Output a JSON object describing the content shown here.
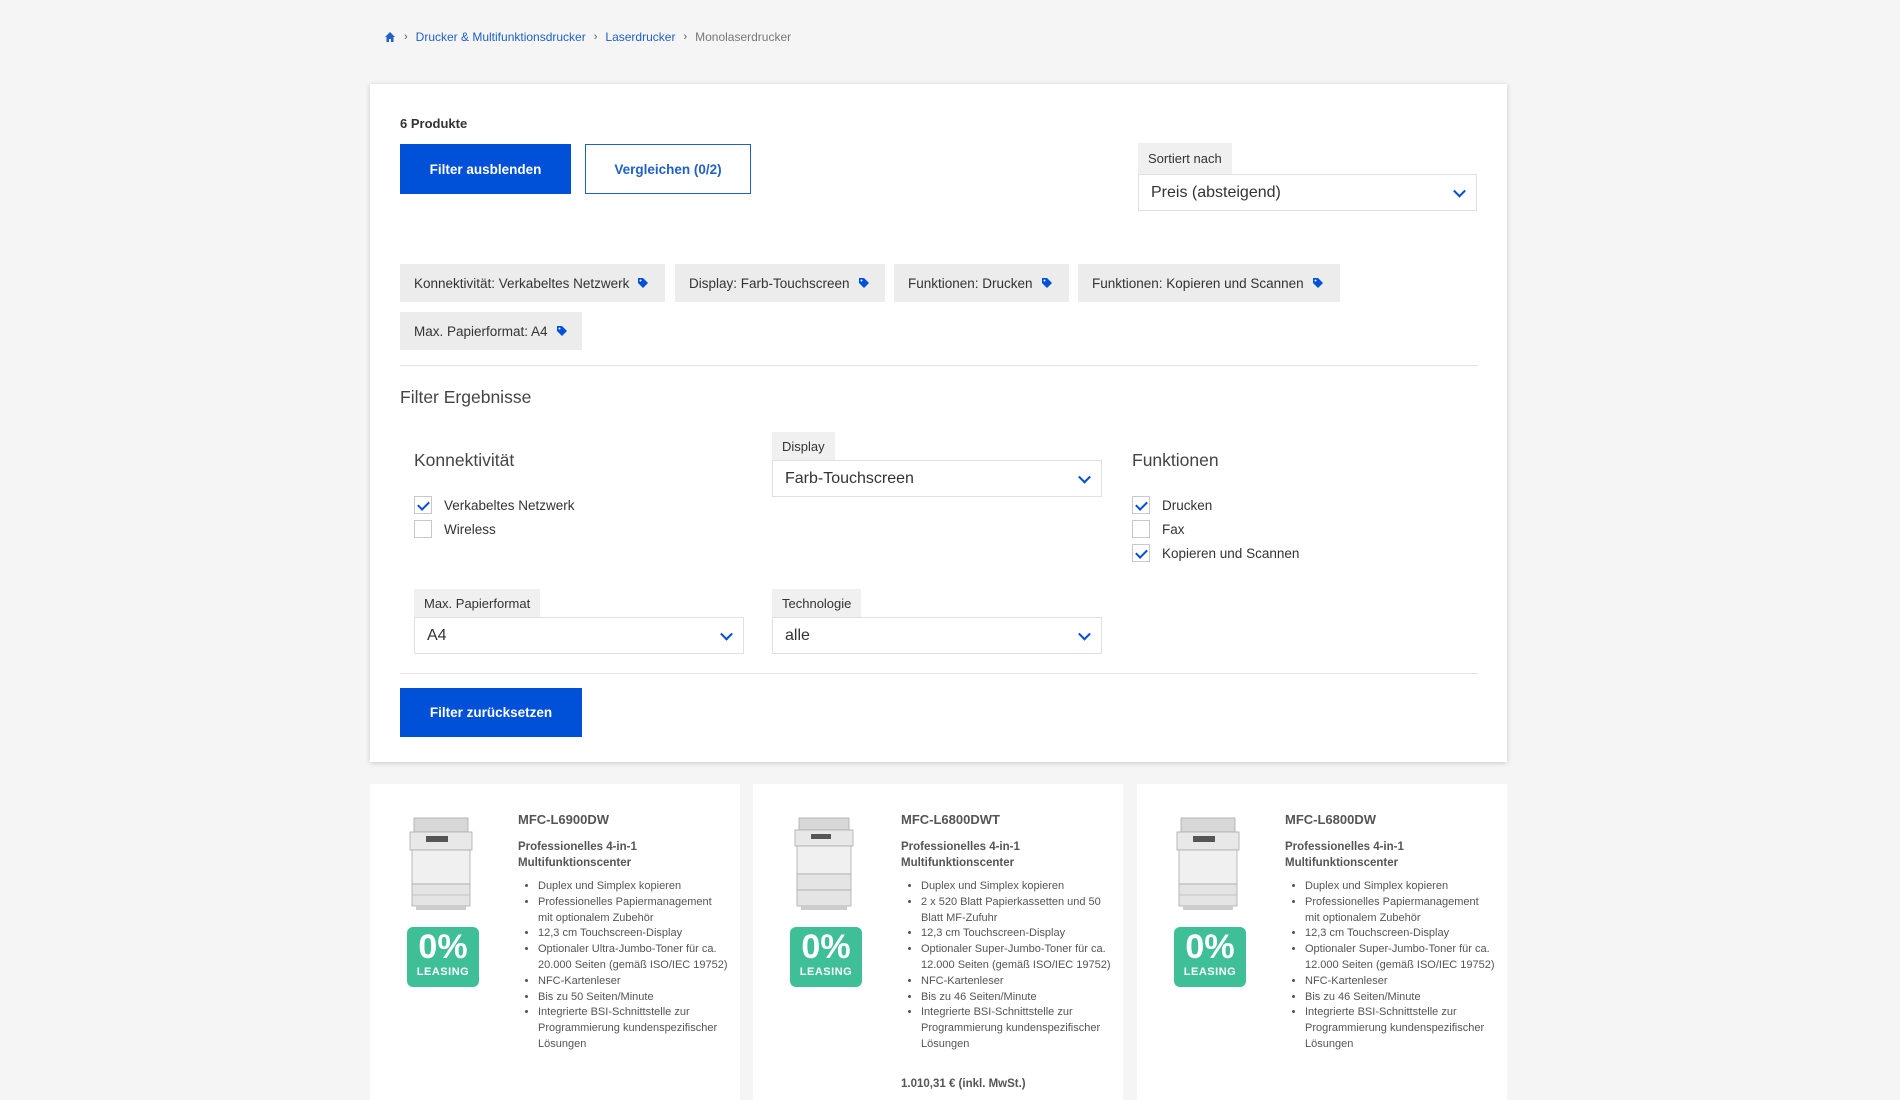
{
  "breadcrumb": {
    "items": [
      "Drucker & Multifunktionsdrucker",
      "Laserdrucker"
    ],
    "current": "Monolaserdrucker"
  },
  "filter_panel": {
    "product_count": "6 Produkte",
    "hide_filter_label": "Filter ausblenden",
    "compare_label": "Vergleichen (0/2)",
    "sort_label": "Sortiert nach",
    "sort_value": "Preis (absteigend)",
    "active_filters": [
      "Konnektivität: Verkabeltes Netzwerk",
      "Display: Farb-Touchscreen",
      "Funktionen: Drucken",
      "Funktionen: Kopieren und Scannen",
      "Max. Papierformat: A4"
    ],
    "section_title": "Filter Ergebnisse",
    "connectivity": {
      "title": "Konnektivität",
      "options": [
        {
          "label": "Verkabeltes Netzwerk",
          "checked": true
        },
        {
          "label": "Wireless",
          "checked": false
        }
      ]
    },
    "display": {
      "label": "Display",
      "value": "Farb-Touchscreen"
    },
    "functions": {
      "title": "Funktionen",
      "options": [
        {
          "label": "Drucken",
          "checked": true
        },
        {
          "label": "Fax",
          "checked": false
        },
        {
          "label": "Kopieren und Scannen",
          "checked": true
        }
      ]
    },
    "paper_format": {
      "label": "Max. Papierformat",
      "value": "A4"
    },
    "technology": {
      "label": "Technologie",
      "value": "alle"
    },
    "reset_label": "Filter zurücksetzen"
  },
  "products": [
    {
      "model": "MFC-L6900DW",
      "subtitle": "Professionelles 4-in-1 Multifunktionscenter",
      "badge_pct": "0%",
      "badge_label": "LEASING",
      "features": [
        "Duplex und Simplex kopieren",
        "Professionelles Papiermanagement mit optionalem Zubehör",
        "12,3 cm Touchscreen-Display",
        "Optionaler Ultra-Jumbo-Toner für ca. 20.000 Seiten (gemäß ISO/IEC 19752)",
        "NFC-Kartenleser",
        "Bis zu 50 Seiten/Minute",
        "Integrierte BSI-Schnittstelle zur Programmierung kundenspezifischer Lösungen"
      ],
      "price": ""
    },
    {
      "model": "MFC-L6800DWT",
      "subtitle": "Professionelles 4-in-1 Multifunktionscenter",
      "badge_pct": "0%",
      "badge_label": "LEASING",
      "features": [
        "Duplex und Simplex kopieren",
        "2 x 520 Blatt Papierkassetten und 50 Blatt MF-Zufuhr",
        "12,3 cm Touchscreen-Display",
        "Optionaler Super-Jumbo-Toner für ca. 12.000 Seiten (gemäß ISO/IEC 19752)",
        "NFC-Kartenleser",
        "Bis zu 46 Seiten/Minute",
        "Integrierte BSI-Schnittstelle zur Programmierung kundenspezifischer Lösungen"
      ],
      "price": "1.010,31 € (inkl. MwSt.)"
    },
    {
      "model": "MFC-L6800DW",
      "subtitle": "Professionelles 4-in-1 Multifunktionscenter",
      "badge_pct": "0%",
      "badge_label": "LEASING",
      "features": [
        "Duplex und Simplex kopieren",
        "Professionelles Papiermanagement mit optionalem Zubehör",
        "12,3 cm Touchscreen-Display",
        "Optionaler Super-Jumbo-Toner für ca. 12.000 Seiten (gemäß ISO/IEC 19752)",
        "NFC-Kartenleser",
        "Bis zu 46 Seiten/Minute",
        "Integrierte BSI-Schnittstelle zur Programmierung kundenspezifischer Lösungen"
      ],
      "price": ""
    }
  ],
  "colors": {
    "accent": "#0050d8",
    "link": "#2060c8",
    "leasing_badge": "#3fbf98",
    "page_bg": "#f5f5f5"
  },
  "icons": {
    "home": "home-icon",
    "separator": "chevron-right-icon",
    "chip": "tag-icon",
    "select": "chevron-down-icon"
  }
}
